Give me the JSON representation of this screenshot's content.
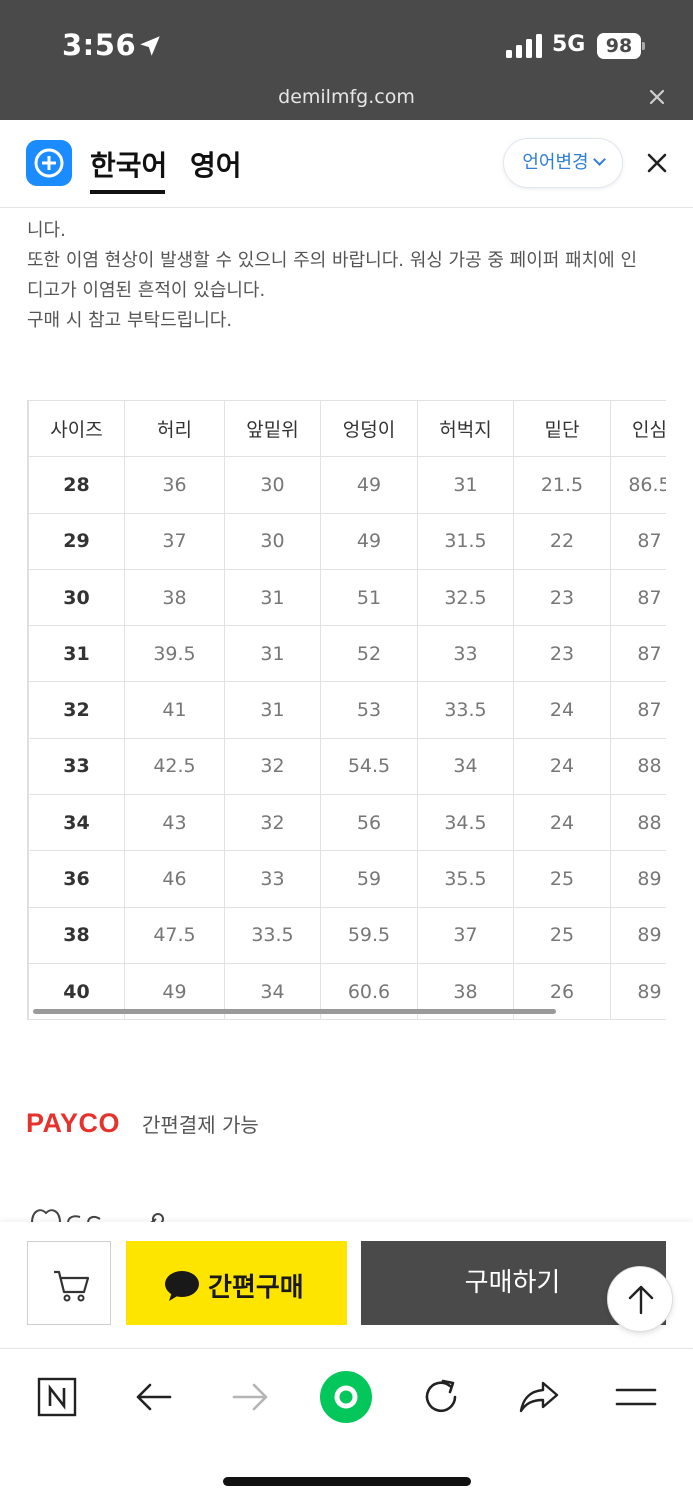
{
  "status_bar": {
    "time": "3:56",
    "network": "5G",
    "battery": "98"
  },
  "browser": {
    "url": "demilmfg.com"
  },
  "translate_bar": {
    "lang_ko": "한국어",
    "lang_en": "영어",
    "change_label": "언어변경"
  },
  "notice": {
    "line1": "니다.",
    "line2": "또한 이염 현상이 발생할 수 있으니 주의 바랍니다. 워싱 가공 중 페이퍼 패치에 인",
    "line3": "디고가 이염된 흔적이 있습니다.",
    "line4": "구매 시 참고 부탁드립니다."
  },
  "size_table": {
    "headers": [
      "사이즈",
      "허리",
      "앞밑위",
      "엉덩이",
      "허벅지",
      "밑단",
      "인심"
    ],
    "rows": [
      [
        "28",
        "36",
        "30",
        "49",
        "31",
        "21.5",
        "86.5"
      ],
      [
        "29",
        "37",
        "30",
        "49",
        "31.5",
        "22",
        "87"
      ],
      [
        "30",
        "38",
        "31",
        "51",
        "32.5",
        "23",
        "87"
      ],
      [
        "31",
        "39.5",
        "31",
        "52",
        "33",
        "23",
        "87"
      ],
      [
        "32",
        "41",
        "31",
        "53",
        "33.5",
        "24",
        "87"
      ],
      [
        "33",
        "42.5",
        "32",
        "54.5",
        "34",
        "24",
        "88"
      ],
      [
        "34",
        "43",
        "32",
        "56",
        "34.5",
        "24",
        "88"
      ],
      [
        "36",
        "46",
        "33",
        "59",
        "35.5",
        "25",
        "89"
      ],
      [
        "38",
        "47.5",
        "33.5",
        "59.5",
        "37",
        "25",
        "89"
      ],
      [
        "40",
        "49",
        "34",
        "60.6",
        "38",
        "26",
        "89"
      ]
    ]
  },
  "payco": {
    "logo": "PAYCO",
    "text": "간편결제 가능"
  },
  "buy_bar": {
    "kakao_label": "간편구매",
    "buy_label": "구매하기"
  },
  "colors": {
    "kakao_yellow": "#fee500",
    "payco_red": "#e5322c",
    "accent_blue": "#2f7fd8",
    "naver_green": "#03c75a"
  }
}
